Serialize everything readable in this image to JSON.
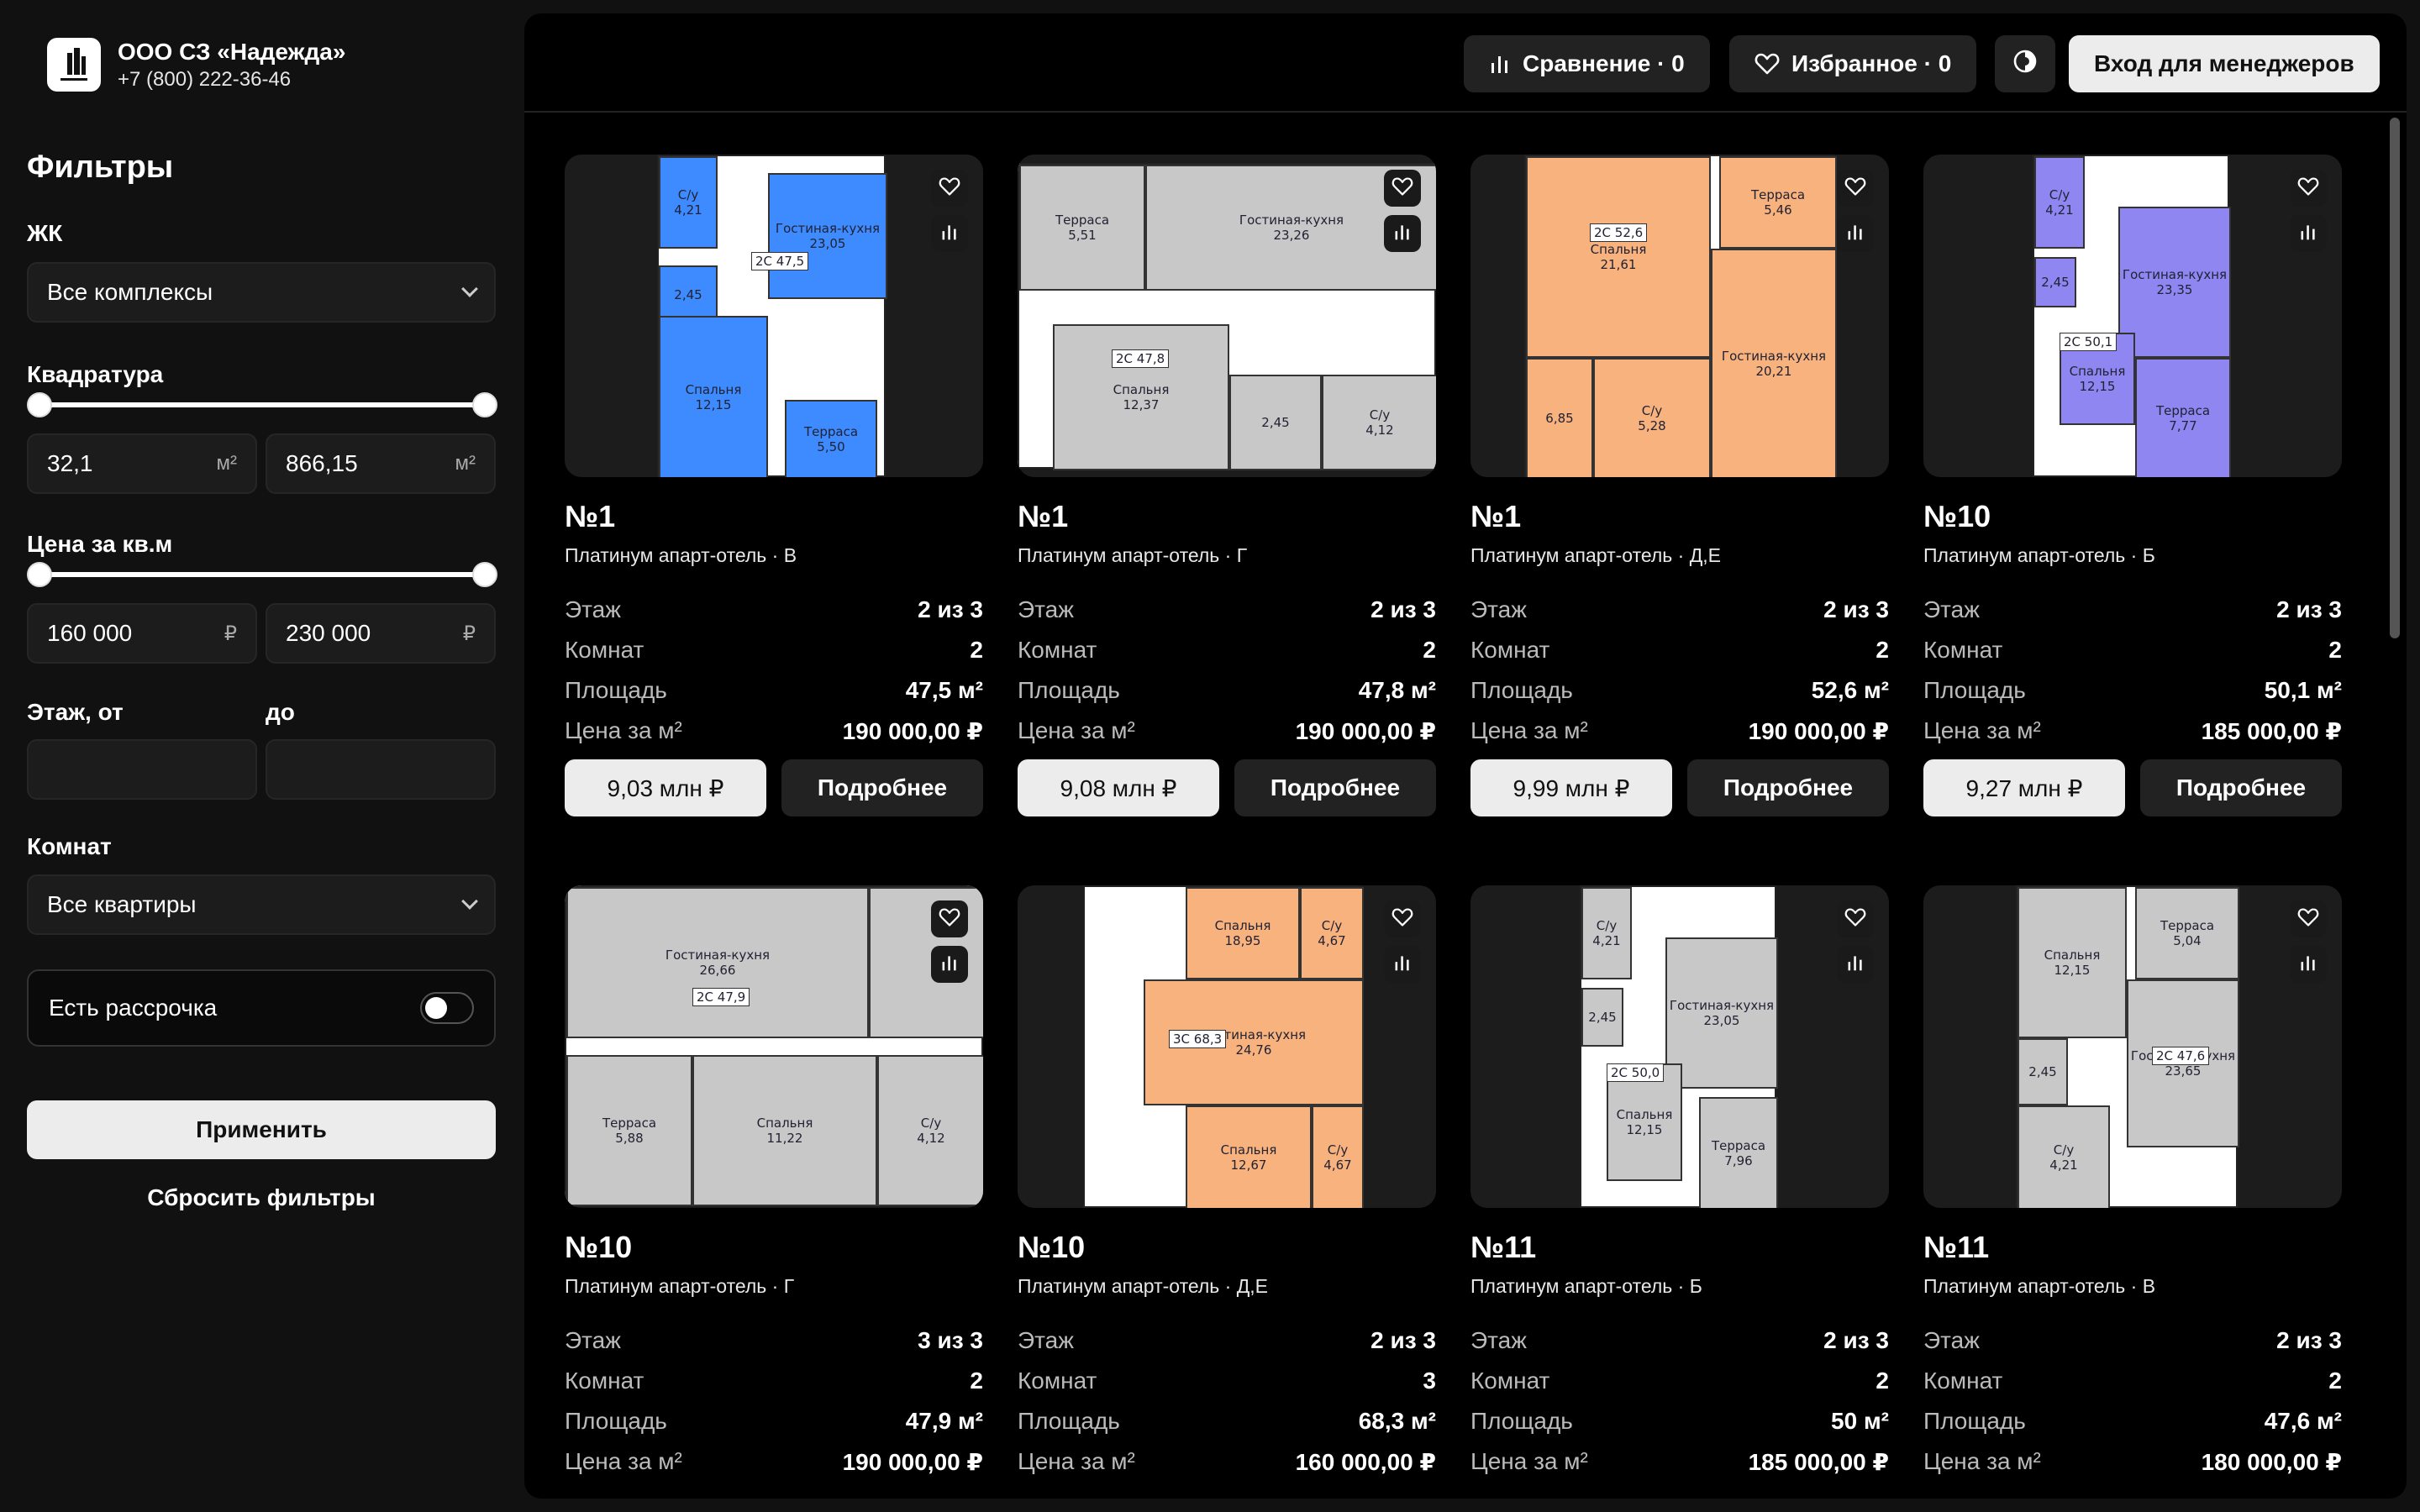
{
  "company": {
    "name": "ООО СЗ «Надежда»",
    "phone": "+7 (800) 222-36-46"
  },
  "filters": {
    "title": "Фильтры",
    "complex_label": "ЖК",
    "complex_value": "Все комплексы",
    "area_label": "Квадратура",
    "area_min": "32,1",
    "area_max": "866,15",
    "area_unit": "м²",
    "price_label": "Цена за кв.м",
    "price_min": "160 000",
    "price_max": "230 000",
    "price_unit": "₽",
    "floor_from_label": "Этаж, от",
    "floor_to_label": "до",
    "rooms_label": "Комнат",
    "rooms_value": "Все квартиры",
    "installment_label": "Есть рассрочка",
    "installment_on": false,
    "apply_label": "Применить",
    "reset_label": "Сбросить фильтры"
  },
  "topbar": {
    "compare_label": "Сравнение · 0",
    "favorites_label": "Избранное · 0",
    "login_label": "Вход для менеджеров"
  },
  "labels": {
    "floor": "Этаж",
    "rooms": "Комнат",
    "area": "Площадь",
    "price_m2": "Цена за м²",
    "more": "Подробнее"
  },
  "cards": [
    {
      "title": "№1",
      "subtitle": "Платинум апарт-отель · В",
      "floor": "2 из 3",
      "rooms": "2",
      "area": "47,5 м²",
      "price_m2": "190 000,00 ₽",
      "price": "9,03 млн ₽",
      "plan_color": "#3d8bff",
      "plan": {
        "r1": "С/у\n4,21",
        "r2": "2,45",
        "r3": "Гостиная-кухня\n23,05",
        "r4": "Спальня\n12,15",
        "r5": "Терраса\n5,50",
        "tag": "2С 47,5"
      }
    },
    {
      "title": "№1",
      "subtitle": "Платинум апарт-отель · Г",
      "floor": "2 из 3",
      "rooms": "2",
      "area": "47,8 м²",
      "price_m2": "190 000,00 ₽",
      "price": "9,08 млн ₽",
      "plan_color": "#c8c8c8",
      "plan": {
        "r1": "Терраса\n5,51",
        "r2": "Гостиная-кухня\n23,26",
        "r3": "Спальня\n12,37",
        "r4": "2,45",
        "r5": "С/у\n4,12",
        "tag": "2С 47,8"
      }
    },
    {
      "title": "№1",
      "subtitle": "Платинум апарт-отель · Д,Е",
      "floor": "2 из 3",
      "rooms": "2",
      "area": "52,6 м²",
      "price_m2": "190 000,00 ₽",
      "price": "9,99 млн ₽",
      "plan_color": "#f7b27e",
      "plan": {
        "r1": "Спальня\n21,61",
        "r2": "Терраса\n5,46",
        "r3": "Гостиная-кухня\n20,21",
        "r4": "6,85",
        "r5": "С/у\n5,28",
        "tag": "2С 52,6"
      }
    },
    {
      "title": "№10",
      "subtitle": "Платинум апарт-отель · Б",
      "floor": "2 из 3",
      "rooms": "2",
      "area": "50,1 м²",
      "price_m2": "185 000,00 ₽",
      "price": "9,27 млн ₽",
      "plan_color": "#8f86f2",
      "plan": {
        "r1": "С/у\n4,21",
        "r2": "2,45",
        "r3": "Гостиная-кухня\n23,35",
        "r4": "Спальня\n12,15",
        "r5": "Терраса\n7,77",
        "tag": "2С 50,1"
      }
    },
    {
      "title": "№10",
      "subtitle": "Платинум апарт-отель · Г",
      "floor": "3 из 3",
      "rooms": "2",
      "area": "47,9 м²",
      "price_m2": "190 000,00 ₽",
      "price": "",
      "plan_color": "#c8c8c8",
      "plan": {
        "r1": "Гостиная-кухня\n26,66",
        "r2": "Терраса\n5,88",
        "r3": "Спальня\n11,22",
        "r4": "С/у\n4,12",
        "r5": "",
        "tag": "2С 47,9"
      }
    },
    {
      "title": "№10",
      "subtitle": "Платинум апарт-отель · Д,Е",
      "floor": "2 из 3",
      "rooms": "3",
      "area": "68,3 м²",
      "price_m2": "160 000,00 ₽",
      "price": "",
      "plan_color": "#f7b27e",
      "plan": {
        "r1": "Спальня\n18,95",
        "r2": "С/у\n4,67",
        "r3": "Гостиная-кухня\n24,76",
        "r4": "Спальня\n12,67",
        "r5": "С/у\n4,67",
        "tag": "3С 68,3"
      }
    },
    {
      "title": "№11",
      "subtitle": "Платинум апарт-отель · Б",
      "floor": "2 из 3",
      "rooms": "2",
      "area": "50 м²",
      "price_m2": "185 000,00 ₽",
      "price": "",
      "plan_color": "#c8c8c8",
      "plan": {
        "r1": "С/у\n4,21",
        "r2": "2,45",
        "r3": "Гостиная-кухня\n23,05",
        "r4": "Спальня\n12,15",
        "r5": "Терраса\n7,96",
        "tag": "2С 50,0"
      }
    },
    {
      "title": "№11",
      "subtitle": "Платинум апарт-отель · В",
      "floor": "2 из 3",
      "rooms": "2",
      "area": "47,6 м²",
      "price_m2": "180 000,00 ₽",
      "price": "",
      "plan_color": "#c8c8c8",
      "plan": {
        "r1": "Спальня\n12,15",
        "r2": "Терраса\n5,04",
        "r3": "Гостиная-кухня\n23,65",
        "r4": "2,45",
        "r5": "С/у\n4,21",
        "tag": "2С 47,6"
      }
    }
  ]
}
